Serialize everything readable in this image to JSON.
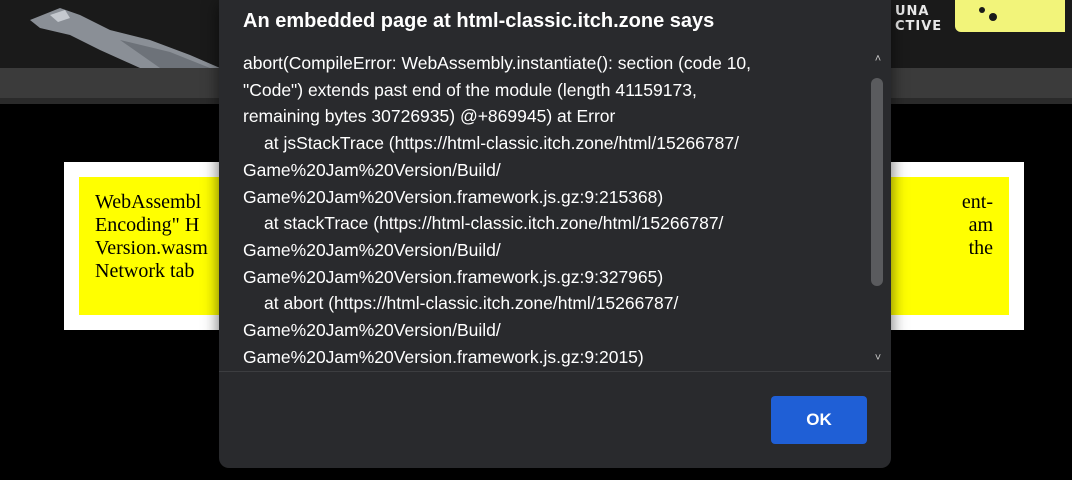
{
  "background_page": {
    "brand_lines": [
      "UNA",
      "CTIVE"
    ],
    "warning_lines": [
      "WebAssembl",
      "Encoding\" H",
      "Version.wasm",
      "Network tab"
    ],
    "warning_lines_right": [
      "ent-",
      "am",
      "the",
      ""
    ],
    "colors": {
      "warning_bg": "#ffff00",
      "banner_logo": "#f2f47a"
    }
  },
  "dialog": {
    "title": "An embedded page at html-classic.itch.zone says",
    "message_lines": [
      {
        "text": "abort(CompileError: WebAssembly.instantiate(): section (code 10,",
        "indent": false
      },
      {
        "text": "\"Code\") extends past end of the module (length 41159173,",
        "indent": false
      },
      {
        "text": "remaining bytes 30726935) @+869945) at Error",
        "indent": false
      },
      {
        "text": "at jsStackTrace (https://html-classic.itch.zone/html/15266787/",
        "indent": true
      },
      {
        "text": "Game%20Jam%20Version/Build/",
        "indent": false
      },
      {
        "text": "Game%20Jam%20Version.framework.js.gz:9:215368)",
        "indent": false
      },
      {
        "text": "at stackTrace (https://html-classic.itch.zone/html/15266787/",
        "indent": true
      },
      {
        "text": "Game%20Jam%20Version/Build/",
        "indent": false
      },
      {
        "text": "Game%20Jam%20Version.framework.js.gz:9:327965)",
        "indent": false
      },
      {
        "text": "at abort (https://html-classic.itch.zone/html/15266787/",
        "indent": true
      },
      {
        "text": "Game%20Jam%20Version/Build/",
        "indent": false
      },
      {
        "text": "Game%20Jam%20Version.framework.js.gz:9:2015)",
        "indent": false
      }
    ],
    "ok_label": "OK",
    "colors": {
      "background": "#292a2d",
      "button": "#1f5fd6"
    }
  }
}
